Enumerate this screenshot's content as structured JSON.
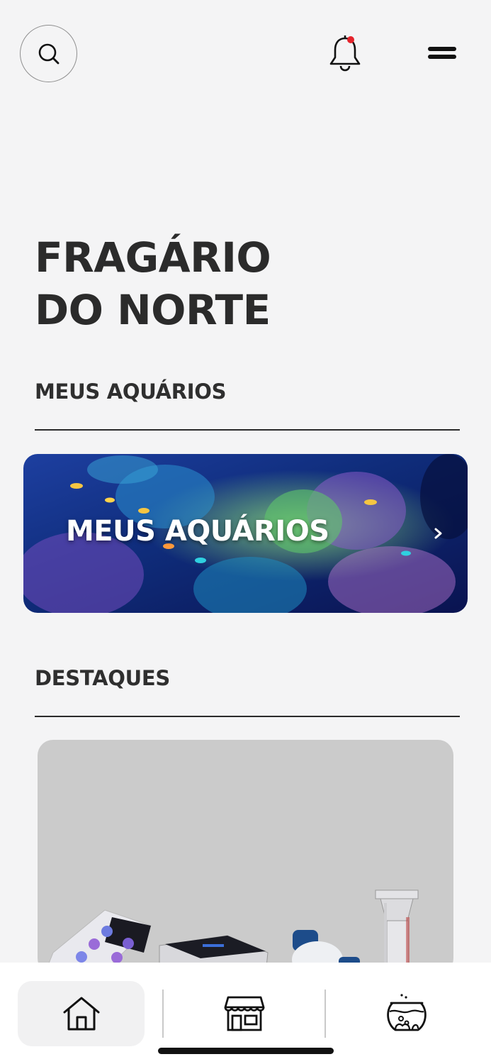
{
  "header": {
    "search_icon": "search-icon",
    "notification_icon": "bell-icon",
    "notification_dot_color": "#e5232b",
    "menu_icon": "menu-icon"
  },
  "title": {
    "line1": "FRAGÁRIO",
    "line2": "DO NORTE"
  },
  "sections": {
    "aquariums_heading": "MEUS AQUÁRIOS",
    "highlights_heading": "DESTAQUES"
  },
  "aquarium_banner": {
    "label": "MEUS AQUÁRIOS",
    "chevron_icon": "chevron-right-icon"
  },
  "bottom_nav": {
    "items": [
      {
        "icon": "home-icon",
        "active": true
      },
      {
        "icon": "store-icon",
        "active": false
      },
      {
        "icon": "aquarium-bowl-icon",
        "active": false
      }
    ]
  }
}
